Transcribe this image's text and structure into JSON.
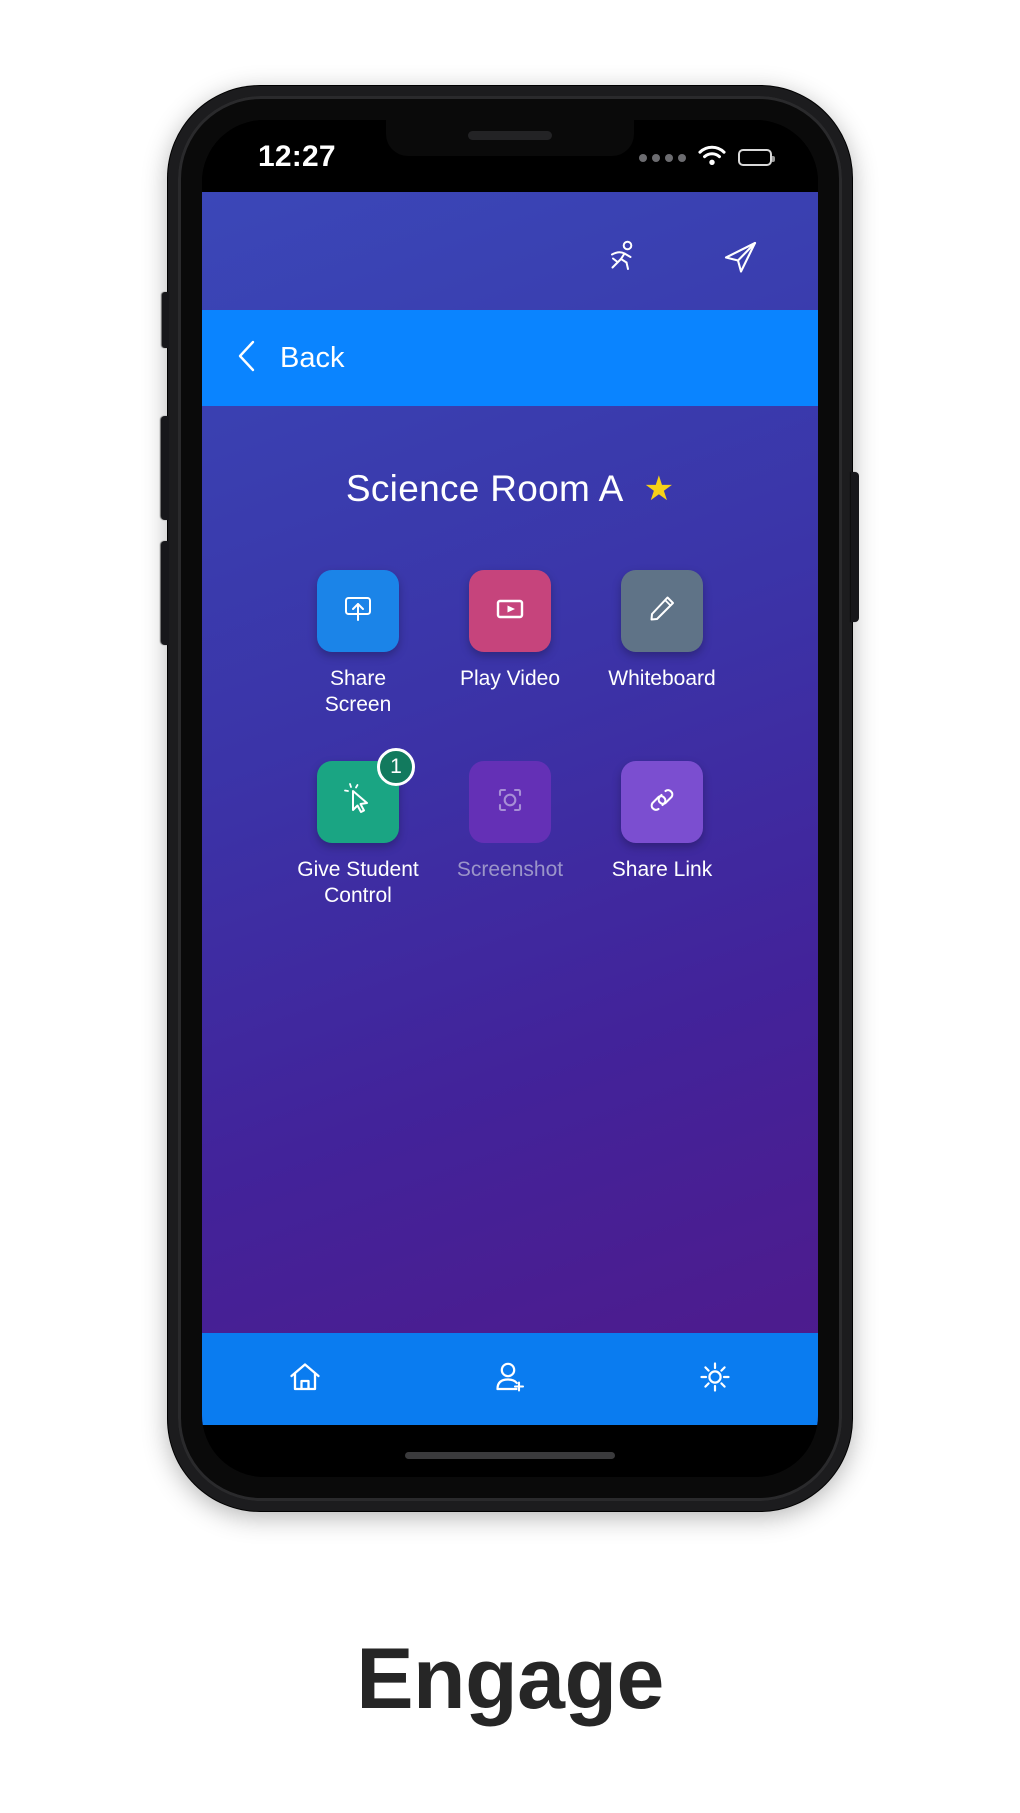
{
  "caption": "Engage",
  "status_bar": {
    "time": "12:27",
    "signal_icon": "signal-dots-icon",
    "wifi_icon": "wifi-icon",
    "battery_icon": "battery-icon",
    "signal_bars": 4
  },
  "app_header": {
    "actions": [
      {
        "name": "running-person-icon",
        "label": "Activity"
      },
      {
        "name": "send-icon",
        "label": "Send"
      }
    ]
  },
  "nav_bar": {
    "back_label": "Back",
    "back_icon": "chevron-left-icon",
    "background": "#0a84ff"
  },
  "room": {
    "title": "Science Room A",
    "favorite_icon": "star-icon",
    "favorite_color": "#f7d117",
    "is_favorite": true
  },
  "tiles": [
    {
      "label": "Share Screen",
      "icon": "share-screen-icon",
      "color": "#1b84e8",
      "enabled": true,
      "badge": null
    },
    {
      "label": "Play Video",
      "icon": "play-video-icon",
      "color": "#c6447c",
      "enabled": true,
      "badge": null
    },
    {
      "label": "Whiteboard",
      "icon": "pencil-icon",
      "color": "#5f7387",
      "enabled": true,
      "badge": null
    },
    {
      "label": "Give Student Control",
      "icon": "cursor-click-icon",
      "color": "#1aa583",
      "enabled": true,
      "badge": "1"
    },
    {
      "label": "Screenshot",
      "icon": "camera-focus-icon",
      "color": "#6430b6",
      "enabled": false,
      "badge": null
    },
    {
      "label": "Share Link",
      "icon": "link-chain-icon",
      "color": "#7b4ed0",
      "enabled": true,
      "badge": null
    }
  ],
  "bottom_nav": {
    "background": "#0a7cf0",
    "items": [
      {
        "name": "nav-home",
        "icon": "home-icon"
      },
      {
        "name": "nav-add-user",
        "icon": "add-user-icon"
      },
      {
        "name": "nav-settings",
        "icon": "gear-icon"
      }
    ]
  }
}
